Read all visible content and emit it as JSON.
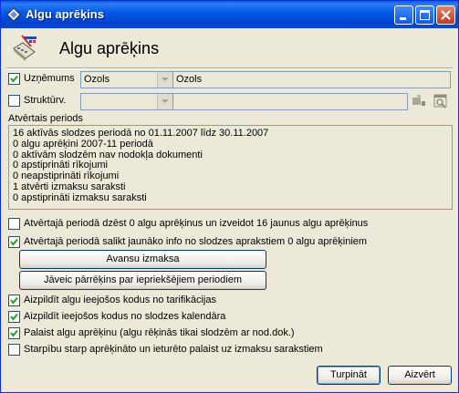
{
  "window": {
    "title": "Algu aprēķins"
  },
  "header": {
    "title": "Algu aprēķins"
  },
  "filters": {
    "uznemums": {
      "label": "Uzņēmums",
      "checked": true,
      "code": "Ozols",
      "name": "Ozols"
    },
    "struktv": {
      "label": "Struktūrv.",
      "checked": false,
      "code": "",
      "name": ""
    }
  },
  "period": {
    "label": "Atvērtais periods",
    "lines": [
      "16 aktīvās slodzes periodā no 01.11.2007 līdz 30.11.2007",
      "0 algu aprēķini 2007-11 periodā",
      "0 aktīvām slodzēm nav nodokļa dokumenti",
      "0 apstiprināti rīkojumi",
      "0 neapstiprināti rīkojumi",
      "1 atvērti izmaksu saraksti",
      "0 apstiprināti izmaksu saraksti"
    ]
  },
  "options": [
    {
      "label": "Atvērtajā periodā dzēst 0 algu aprēķinus un izveidot 16 jaunus algu aprēķinus",
      "checked": false
    },
    {
      "label": "Atvērtajā periodā salikt jaunāko info no slodzes aprakstiem 0 algu aprēķiniem",
      "checked": true
    }
  ],
  "buttons": {
    "avansu": "Avansu izmaksa",
    "parrekins": "Jāveic pārrēķins par iepriekšējiem periodiem",
    "turpinat": "Turpināt",
    "aizvert": "Aizvērt"
  },
  "checks": [
    {
      "label": "Aizpildīt algu ieejošos kodus no tarifikācijas",
      "checked": true
    },
    {
      "label": "Aizpildīt ieejošos kodus no slodzes kalendāra",
      "checked": true
    },
    {
      "label": "Palaist algu aprēķinu (algu rēķinās tikai slodzēm ar nod.dok.)",
      "checked": true
    },
    {
      "label": "Starpību starp aprēķināto un ieturēto palaist uz izmaksu sarakstiem",
      "checked": false
    }
  ],
  "colors": {
    "titlebar": "#0055e5",
    "dialog_bg": "#ece9d8",
    "check_mark": "#21a121"
  },
  "icons": [
    "app-icon",
    "minimize-icon",
    "maximize-icon",
    "close-icon",
    "payroll-calc-icon",
    "dropdown-arrow-icon",
    "tree-select-icon",
    "search-window-icon"
  ]
}
